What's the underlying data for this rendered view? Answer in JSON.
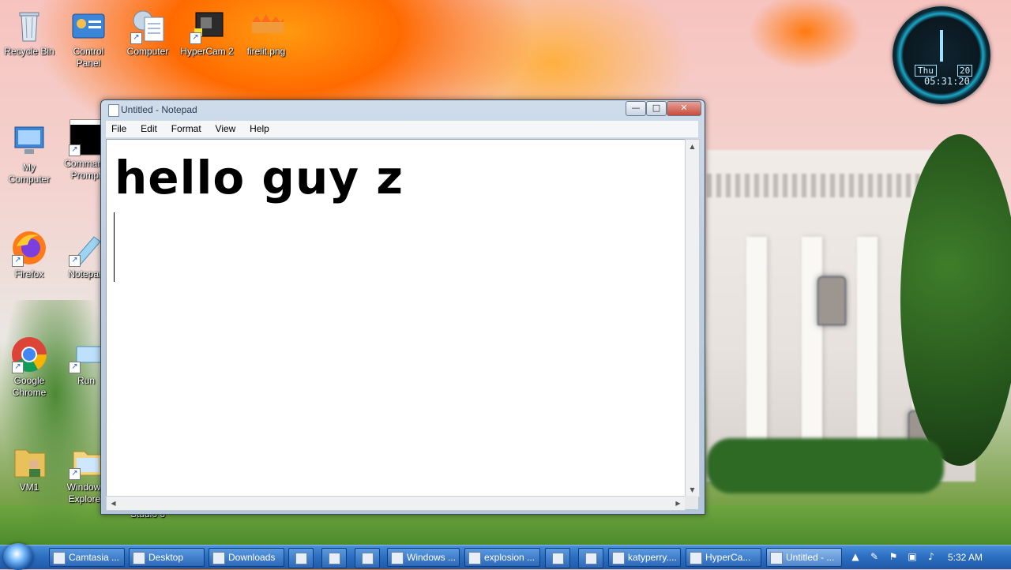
{
  "desktop": {
    "icons": [
      {
        "label": "Recycle Bin"
      },
      {
        "label": "Control\nPanel"
      },
      {
        "label": "Computer"
      },
      {
        "label": "HyperCam 2"
      },
      {
        "label": "firelit.png"
      },
      {
        "label": "My\nComputer"
      },
      {
        "label": "Command\nPrompt"
      },
      {
        "label": "Firefox"
      },
      {
        "label": "Notepad"
      },
      {
        "label": "Google\nChrome"
      },
      {
        "label": "Run"
      },
      {
        "label": "VM1"
      },
      {
        "label": "Windows\nExplorer"
      },
      {
        "label": "Studio 6"
      }
    ]
  },
  "gadget": {
    "day": "Thu",
    "date": "20",
    "time": "05:31:20"
  },
  "notepad": {
    "title": "Untitled - Notepad",
    "menu": [
      "File",
      "Edit",
      "Format",
      "View",
      "Help"
    ],
    "content": "hello guy z",
    "controls": {
      "minimize": "—",
      "maximize": "□",
      "close": "✕"
    }
  },
  "taskbar": {
    "buttons": [
      {
        "label": "Camtasia ..."
      },
      {
        "label": "Desktop"
      },
      {
        "label": "Downloads"
      },
      {
        "label": "Windows ..."
      },
      {
        "label": "explosion ..."
      },
      {
        "label": "katyperry...."
      },
      {
        "label": "HyperCa..."
      },
      {
        "label": "Untitled - ..."
      }
    ],
    "clock": "5:32 AM"
  }
}
